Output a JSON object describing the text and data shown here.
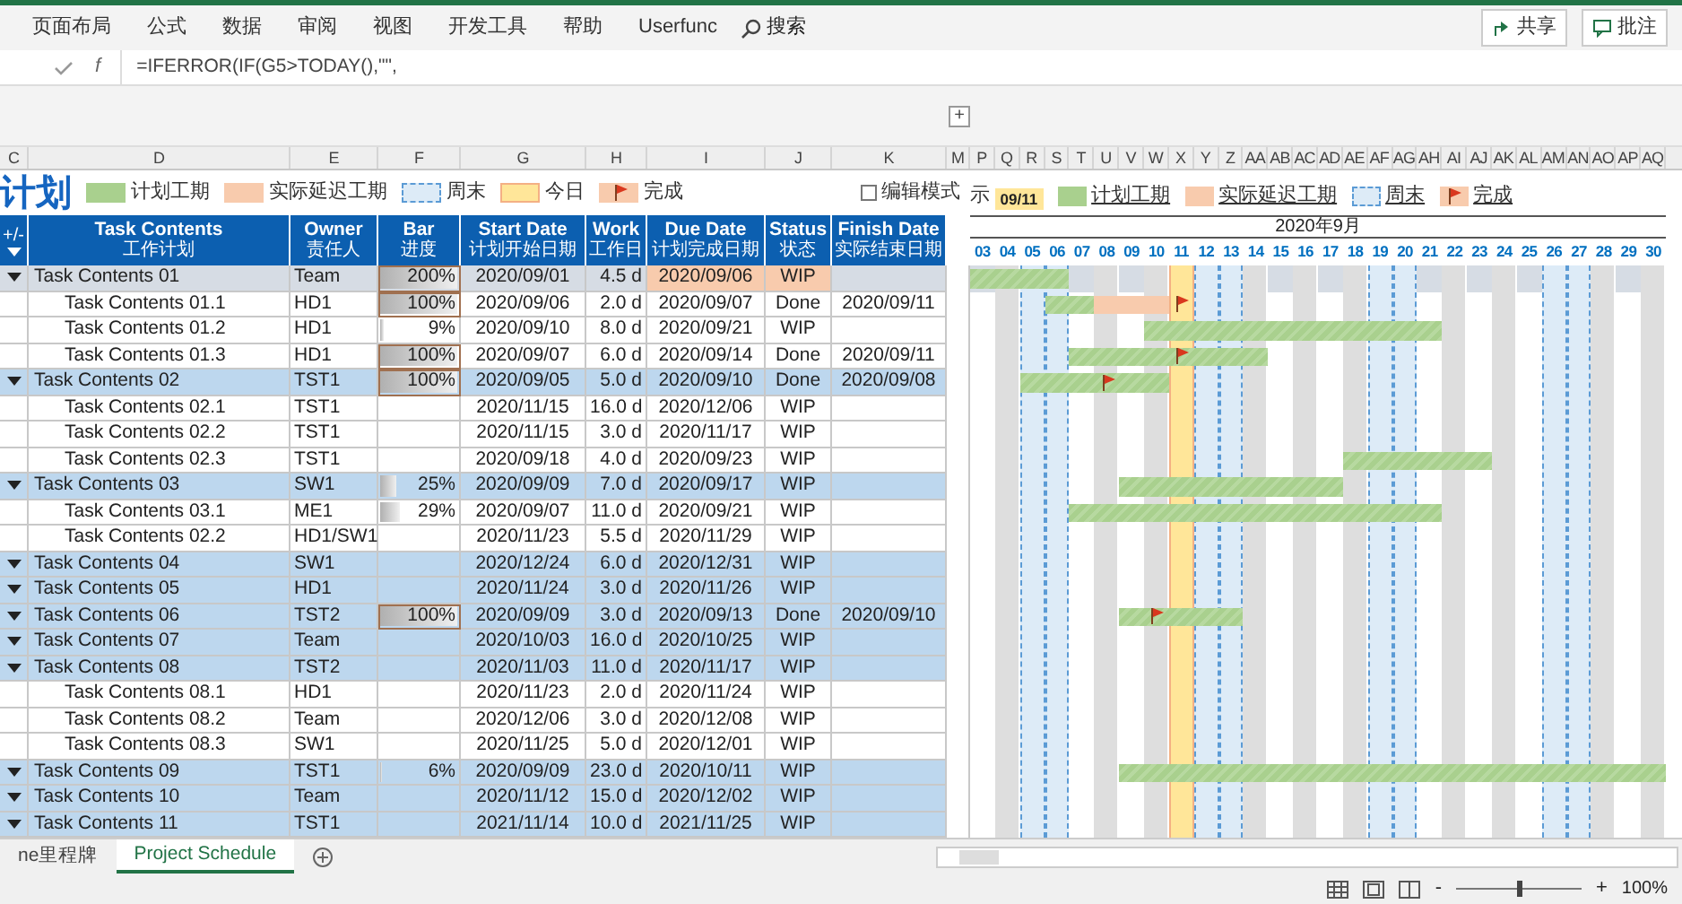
{
  "ribbon": {
    "tabs": [
      "页面布局",
      "公式",
      "数据",
      "审阅",
      "视图",
      "开发工具",
      "帮助",
      "Userfunc"
    ],
    "search": "搜索",
    "buttons": [
      {
        "label": "共享",
        "kind": "share"
      },
      {
        "label": "批注",
        "kind": "comment"
      }
    ]
  },
  "formula_bar": {
    "fx_label": "f",
    "formula": "=IFERROR(IF(G5>TODAY(),\"\","
  },
  "outline_toggle": "+",
  "column_letters": [
    "C",
    "D",
    "E",
    "F",
    "G",
    "H",
    "I",
    "J",
    "K",
    "M",
    "P",
    "Q",
    "R",
    "S",
    "T",
    "U",
    "V",
    "W",
    "X",
    "Y",
    "Z",
    "AA",
    "AB",
    "AC",
    "AD",
    "AE",
    "AF",
    "AG",
    "AH",
    "AI",
    "AJ",
    "AK",
    "AL",
    "AM",
    "AN",
    "AO",
    "AP",
    "AQ"
  ],
  "title": "计划",
  "legend": [
    {
      "label": "计划工期",
      "kind": "plan"
    },
    {
      "label": "实际延迟工期",
      "kind": "delay"
    },
    {
      "label": "周末",
      "kind": "weekend"
    },
    {
      "label": "今日",
      "kind": "today"
    },
    {
      "label": "完成",
      "kind": "finish"
    }
  ],
  "edit_mode": {
    "label": "编辑模式",
    "checked": false
  },
  "table": {
    "toggle_header": "+/-",
    "columns": [
      {
        "title": "Task Contents",
        "subtitle": "工作计划"
      },
      {
        "title": "Owner",
        "subtitle": "责任人"
      },
      {
        "title": "Bar",
        "subtitle": "进度"
      },
      {
        "title": "Start Date",
        "subtitle": "计划开始日期"
      },
      {
        "title": "Work",
        "subtitle": "工作日"
      },
      {
        "title": "Due Date",
        "subtitle": "计划完成日期"
      },
      {
        "title": "Status",
        "subtitle": "状态"
      },
      {
        "title": "Finish Date",
        "subtitle": "实际结束日期"
      }
    ],
    "rows": [
      {
        "task": "Task Contents 01",
        "owner": "Team",
        "bar": "200%",
        "level": 1,
        "start": "2020/09/01",
        "work": "4.5 d",
        "due": "2020/09/06",
        "status": "WIP",
        "selected": true,
        "overdue": true,
        "expanded": true,
        "children": [
          {
            "task": "Task Contents 01.1",
            "owner": "HD1",
            "bar": "100%",
            "level": 1,
            "start": "2020/09/06",
            "work": "2.0 d",
            "due": "2020/09/07",
            "status": "Done",
            "finish": "2020/09/11",
            "selected": false,
            "overdue": false
          },
          {
            "task": "Task Contents 01.2",
            "owner": "HD1",
            "bar": "9%",
            "level": 0.09,
            "start": "2020/09/10",
            "work": "8.0 d",
            "due": "2020/09/21",
            "status": "WIP",
            "selected": false,
            "overdue": false
          },
          {
            "task": "Task Contents 01.3",
            "owner": "HD1",
            "bar": "100%",
            "level": 1,
            "start": "2020/09/07",
            "work": "6.0 d",
            "due": "2020/09/14",
            "status": "Done",
            "finish": "2020/09/11",
            "selected": false,
            "overdue": false
          }
        ]
      },
      {
        "task": "Task Contents 02",
        "owner": "TST1",
        "bar": "100%",
        "level": 1,
        "start": "2020/09/05",
        "work": "5.0 d",
        "due": "2020/09/10",
        "status": "Done",
        "finish": "2020/09/08",
        "selected": false,
        "overdue": false,
        "expanded": true,
        "children": [
          {
            "task": "Task Contents 02.1",
            "owner": "TST1",
            "start": "2020/11/15",
            "work": "16.0 d",
            "due": "2020/12/06",
            "status": "WIP",
            "selected": false,
            "overdue": false
          },
          {
            "task": "Task Contents 02.2",
            "owner": "TST1",
            "start": "2020/11/15",
            "work": "3.0 d",
            "due": "2020/11/17",
            "status": "WIP",
            "selected": false,
            "overdue": false
          },
          {
            "task": "Task Contents 02.3",
            "owner": "TST1",
            "start": "2020/09/18",
            "work": "4.0 d",
            "due": "2020/09/23",
            "status": "WIP",
            "selected": false,
            "overdue": false
          }
        ]
      },
      {
        "task": "Task Contents 03",
        "owner": "SW1",
        "bar": "25%",
        "level": 0.25,
        "start": "2020/09/09",
        "work": "7.0 d",
        "due": "2020/09/17",
        "status": "WIP",
        "selected": false,
        "overdue": false,
        "expanded": true,
        "children": [
          {
            "task": "Task Contents 03.1",
            "owner": "ME1",
            "bar": "29%",
            "level": 0.29,
            "start": "2020/09/07",
            "work": "11.0 d",
            "due": "2020/09/21",
            "status": "WIP",
            "selected": false,
            "overdue": false
          },
          {
            "task": "Task Contents 02.2",
            "owner": "HD1/SW1",
            "start": "2020/11/23",
            "work": "5.5 d",
            "due": "2020/11/29",
            "status": "WIP",
            "selected": false,
            "overdue": false
          }
        ]
      },
      {
        "task": "Task Contents 04",
        "owner": "SW1",
        "start": "2020/12/24",
        "work": "6.0 d",
        "due": "2020/12/31",
        "status": "WIP",
        "selected": false,
        "overdue": false,
        "expanded": true
      },
      {
        "task": "Task Contents 05",
        "owner": "HD1",
        "start": "2020/11/24",
        "work": "3.0 d",
        "due": "2020/11/26",
        "status": "WIP",
        "selected": false,
        "overdue": false,
        "expanded": true
      },
      {
        "task": "Task Contents 06",
        "owner": "TST2",
        "bar": "100%",
        "level": 1,
        "start": "2020/09/09",
        "work": "3.0 d",
        "due": "2020/09/13",
        "status": "Done",
        "finish": "2020/09/10",
        "selected": false,
        "overdue": false,
        "expanded": true
      },
      {
        "task": "Task Contents 07",
        "owner": "Team",
        "start": "2020/10/03",
        "work": "16.0 d",
        "due": "2020/10/25",
        "status": "WIP",
        "selected": false,
        "overdue": false,
        "expanded": true
      },
      {
        "task": "Task Contents 08",
        "owner": "TST2",
        "start": "2020/11/03",
        "work": "11.0 d",
        "due": "2020/11/17",
        "status": "WIP",
        "selected": false,
        "overdue": false,
        "expanded": true,
        "children": [
          {
            "task": "Task Contents 08.1",
            "owner": "HD1",
            "start": "2020/11/23",
            "work": "2.0 d",
            "due": "2020/11/24",
            "status": "WIP",
            "selected": false,
            "overdue": false
          },
          {
            "task": "Task Contents 08.2",
            "owner": "Team",
            "start": "2020/12/06",
            "work": "3.0 d",
            "due": "2020/12/08",
            "status": "WIP",
            "selected": false,
            "overdue": false
          },
          {
            "task": "Task Contents 08.3",
            "owner": "SW1",
            "start": "2020/11/25",
            "work": "5.0 d",
            "due": "2020/12/01",
            "status": "WIP",
            "selected": false,
            "overdue": false
          }
        ]
      },
      {
        "task": "Task Contents 09",
        "owner": "TST1",
        "bar": "6%",
        "level": 0.06,
        "start": "2020/09/09",
        "work": "23.0 d",
        "due": "2020/10/11",
        "status": "WIP",
        "selected": false,
        "overdue": false,
        "expanded": true
      },
      {
        "task": "Task Contents 10",
        "owner": "Team",
        "start": "2020/11/12",
        "work": "15.0 d",
        "due": "2020/12/02",
        "status": "WIP",
        "selected": false,
        "overdue": false,
        "expanded": true
      },
      {
        "task": "Task Contents 11",
        "owner": "TST1",
        "start": "2021/11/14",
        "work": "10.0 d",
        "due": "2021/11/25",
        "status": "WIP",
        "selected": false,
        "overdue": false,
        "expanded": true
      }
    ]
  },
  "gantt": {
    "today_label": "示",
    "today_date": "09/11",
    "legend": [
      {
        "label": "计划工期",
        "kind": "plan"
      },
      {
        "label": "实际延迟工期",
        "kind": "delay"
      },
      {
        "label": "周末",
        "kind": "weekend"
      },
      {
        "label": "完成",
        "kind": "finish"
      }
    ],
    "month": "2020年9月",
    "days": [
      {
        "label": "03",
        "weekend": false,
        "today": false
      },
      {
        "label": "04",
        "weekend": false,
        "today": false
      },
      {
        "label": "05",
        "weekend": true,
        "today": false
      },
      {
        "label": "06",
        "weekend": true,
        "today": false
      },
      {
        "label": "07",
        "weekend": false,
        "today": false
      },
      {
        "label": "08",
        "weekend": false,
        "today": false
      },
      {
        "label": "09",
        "weekend": false,
        "today": false
      },
      {
        "label": "10",
        "weekend": false,
        "today": false
      },
      {
        "label": "11",
        "weekend": false,
        "today": true
      },
      {
        "label": "12",
        "weekend": true,
        "today": false
      },
      {
        "label": "13",
        "weekend": true,
        "today": false
      },
      {
        "label": "14",
        "weekend": false,
        "today": false
      },
      {
        "label": "15",
        "weekend": false,
        "today": false
      },
      {
        "label": "16",
        "weekend": false,
        "today": false
      },
      {
        "label": "17",
        "weekend": false,
        "today": false
      },
      {
        "label": "18",
        "weekend": false,
        "today": false
      },
      {
        "label": "19",
        "weekend": true,
        "today": false
      },
      {
        "label": "20",
        "weekend": true,
        "today": false
      },
      {
        "label": "21",
        "weekend": false,
        "today": false
      },
      {
        "label": "22",
        "weekend": false,
        "today": false
      },
      {
        "label": "23",
        "weekend": false,
        "today": false
      },
      {
        "label": "24",
        "weekend": false,
        "today": false
      },
      {
        "label": "25",
        "weekend": false,
        "today": false
      },
      {
        "label": "26",
        "weekend": true,
        "today": false
      },
      {
        "label": "27",
        "weekend": true,
        "today": false
      },
      {
        "label": "28",
        "weekend": false,
        "today": false
      },
      {
        "label": "29",
        "weekend": false,
        "today": false
      },
      {
        "label": "30",
        "weekend": false,
        "today": false
      }
    ]
  },
  "sheet_tabs": [
    {
      "label": "ne里程牌",
      "selected": false
    },
    {
      "label": "Project Schedule",
      "selected": true
    }
  ],
  "status_bar": {
    "zoom": {
      "minus": "-",
      "plus": "+",
      "level": 0.5,
      "label": "100%"
    }
  }
}
